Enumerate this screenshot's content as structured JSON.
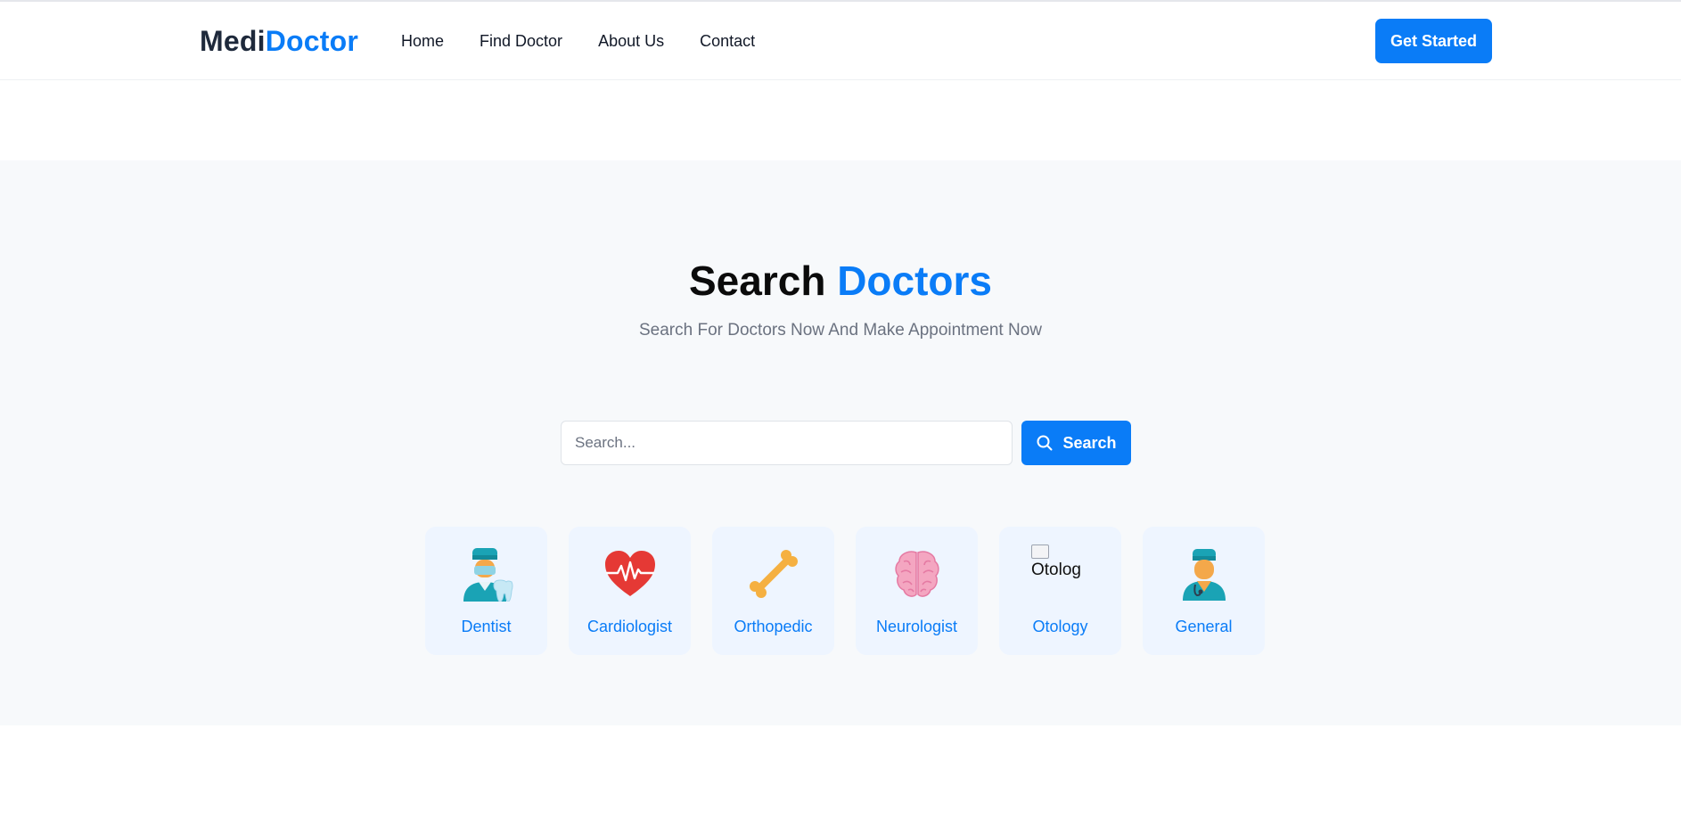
{
  "brand": {
    "part1": "Medi",
    "part2": "Doctor"
  },
  "nav": {
    "items": [
      {
        "label": "Home"
      },
      {
        "label": "Find Doctor"
      },
      {
        "label": "About Us"
      },
      {
        "label": "Contact"
      }
    ]
  },
  "cta_label": "Get Started",
  "hero": {
    "title_part1": "Search",
    "title_part2": "Doctors",
    "subtitle": "Search For Doctors Now And Make Appointment Now"
  },
  "search": {
    "placeholder": "Search...",
    "button_label": "Search",
    "button_icon": "search-icon"
  },
  "categories": [
    {
      "label": "Dentist",
      "icon": "dentist-icon"
    },
    {
      "label": "Cardiologist",
      "icon": "heart-pulse-icon"
    },
    {
      "label": "Orthopedic",
      "icon": "bone-icon"
    },
    {
      "label": "Neurologist",
      "icon": "brain-icon"
    },
    {
      "label": "Otology",
      "icon": "broken-image-icon",
      "alt_text": "Otolog"
    },
    {
      "label": "General",
      "icon": "doctor-icon"
    }
  ],
  "colors": {
    "accent": "#0a7cf7",
    "hero_bg": "#f7f9fb",
    "card_bg": "#eef5ff"
  }
}
